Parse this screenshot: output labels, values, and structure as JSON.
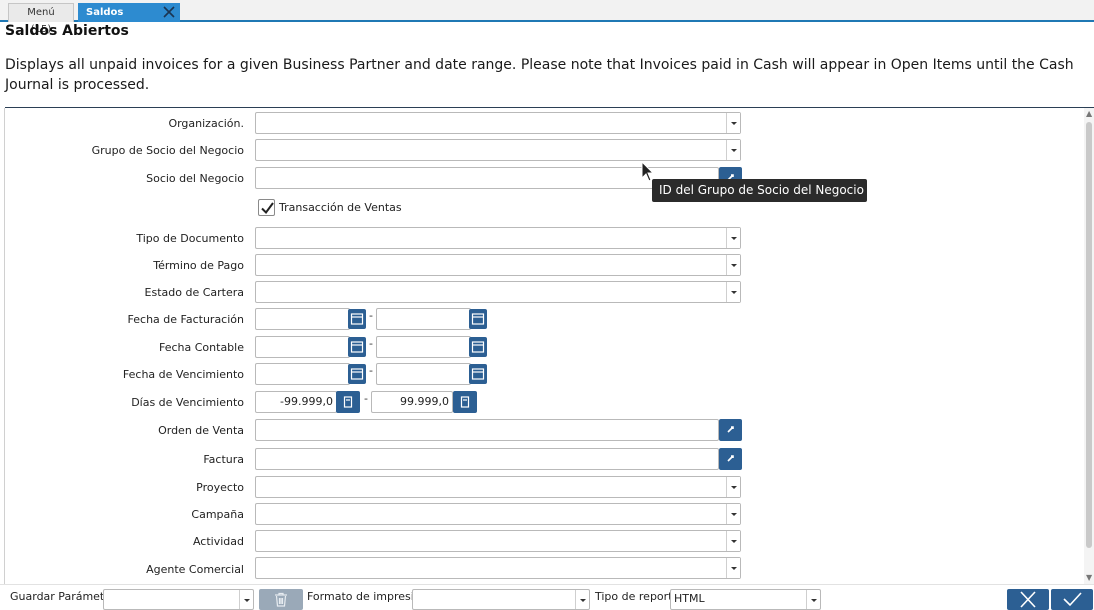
{
  "tabs": [
    {
      "label": "Menú (15)"
    },
    {
      "label": "Saldos Abiertos"
    }
  ],
  "header": {
    "title": "Saldos Abiertos",
    "description": "Displays all unpaid invoices for a given Business Partner and date range. Please note that Invoices paid in Cash will appear in Open Items until the Cash Journal is processed."
  },
  "form": {
    "organizacion": "Organización.",
    "grupo_socio": "Grupo de Socio del Negocio",
    "socio": "Socio del Negocio",
    "transaccion_ventas": "Transacción de Ventas",
    "transaccion_ventas_checked": true,
    "tipo_documento": "Tipo de Documento",
    "termino_pago": "Término de Pago",
    "estado_cartera": "Estado de Cartera",
    "fecha_facturacion": "Fecha de Facturación",
    "fecha_contable": "Fecha Contable",
    "fecha_vencimiento": "Fecha de Vencimiento",
    "dias_vencimiento": "Días de Vencimiento",
    "dias_from": "-99.999,0",
    "dias_to": "99.999,0",
    "range_sep": "-",
    "orden_venta": "Orden de Venta",
    "factura": "Factura",
    "proyecto": "Proyecto",
    "campana": "Campaña",
    "actividad": "Actividad",
    "agente_comercial": "Agente Comercial"
  },
  "tooltip": "ID del Grupo de Socio del Negocio",
  "footer": {
    "guardar_parametro": "Guardar Parámetro",
    "formato_impresion": "Formato de impresión",
    "tipo_reporte": "Tipo de reporte",
    "tipo_reporte_value": "HTML"
  },
  "colors": {
    "accent": "#2d8bd0",
    "button": "#2c5f93",
    "tooltip_bg": "#2b2b2b"
  }
}
